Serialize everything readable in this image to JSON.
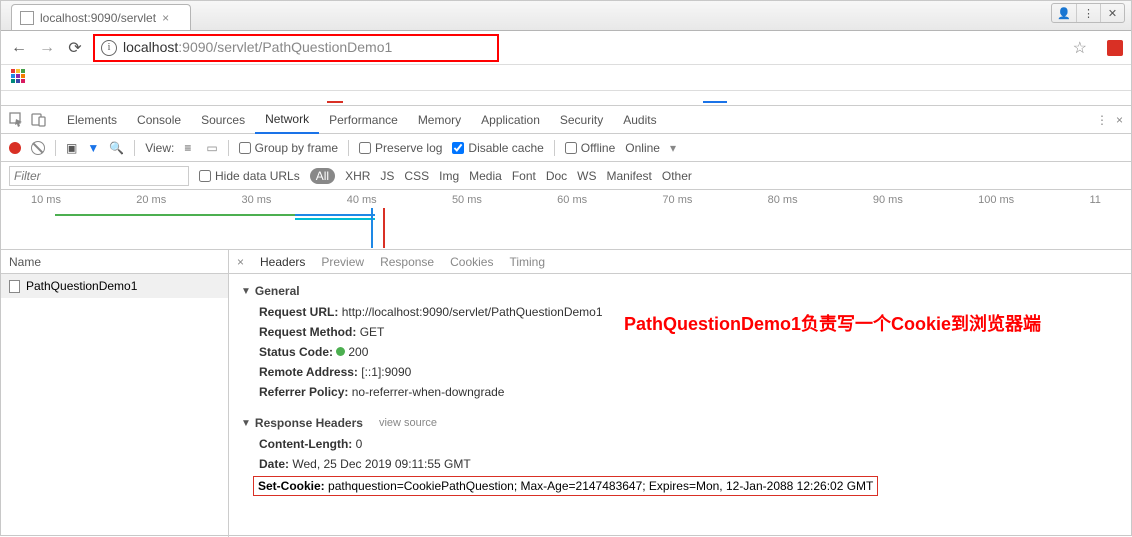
{
  "window_controls": {
    "user": "👤",
    "more": "⋮",
    "close": "✕"
  },
  "tab": {
    "title": "localhost:9090/servlet"
  },
  "address": {
    "host": "localhost",
    "port": ":9090",
    "path": "/servlet/PathQuestionDemo1"
  },
  "devtools": {
    "tabs": [
      "Elements",
      "Console",
      "Sources",
      "Network",
      "Performance",
      "Memory",
      "Application",
      "Security",
      "Audits"
    ],
    "active_tab": "Network",
    "toolbar": {
      "view_label": "View:",
      "group_by_frame": "Group by frame",
      "preserve_log": "Preserve log",
      "disable_cache": "Disable cache",
      "disable_cache_checked": true,
      "offline": "Offline",
      "online": "Online"
    },
    "filter": {
      "placeholder": "Filter",
      "hide_data_urls": "Hide data URLs",
      "types": [
        "All",
        "XHR",
        "JS",
        "CSS",
        "Img",
        "Media",
        "Font",
        "Doc",
        "WS",
        "Manifest",
        "Other"
      ]
    },
    "timeline_ticks": [
      "10 ms",
      "20 ms",
      "30 ms",
      "40 ms",
      "50 ms",
      "60 ms",
      "70 ms",
      "80 ms",
      "90 ms",
      "100 ms",
      "11"
    ],
    "name_header": "Name",
    "requests": [
      {
        "name": "PathQuestionDemo1"
      }
    ],
    "detail_tabs": [
      "Headers",
      "Preview",
      "Response",
      "Cookies",
      "Timing"
    ],
    "detail_active": "Headers",
    "general_label": "General",
    "general": {
      "request_url_label": "Request URL:",
      "request_url": "http://localhost:9090/servlet/PathQuestionDemo1",
      "request_method_label": "Request Method:",
      "request_method": "GET",
      "status_code_label": "Status Code:",
      "status_code": "200",
      "remote_address_label": "Remote Address:",
      "remote_address": "[::1]:9090",
      "referrer_policy_label": "Referrer Policy:",
      "referrer_policy": "no-referrer-when-downgrade"
    },
    "response_headers_label": "Response Headers",
    "view_source": "view source",
    "response_headers": {
      "content_length_label": "Content-Length:",
      "content_length": "0",
      "date_label": "Date:",
      "date": "Wed, 25 Dec 2019 09:11:55 GMT",
      "set_cookie_label": "Set-Cookie:",
      "set_cookie": "pathquestion=CookiePathQuestion; Max-Age=2147483647; Expires=Mon, 12-Jan-2088 12:26:02 GMT"
    }
  },
  "annotation": "PathQuestionDemo1负责写一个Cookie到浏览器端"
}
